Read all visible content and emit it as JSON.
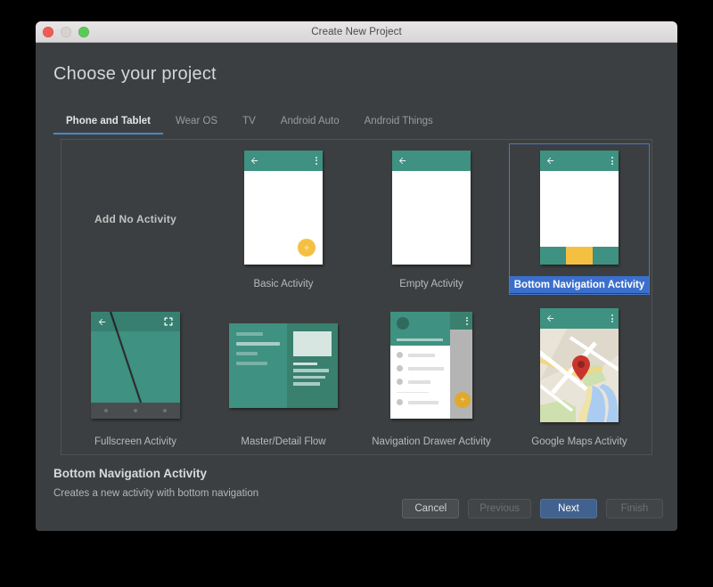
{
  "window": {
    "title": "Create New Project",
    "traffic_lights": [
      "close-red",
      "minimize-gray",
      "zoom-green"
    ]
  },
  "page": {
    "heading": "Choose your project"
  },
  "tabs": [
    {
      "label": "Phone and Tablet",
      "active": true
    },
    {
      "label": "Wear OS",
      "active": false
    },
    {
      "label": "TV",
      "active": false
    },
    {
      "label": "Android Auto",
      "active": false
    },
    {
      "label": "Android Things",
      "active": false
    }
  ],
  "templates": [
    {
      "label": "Add No Activity",
      "kind": "text-only",
      "selected": false
    },
    {
      "label": "Basic Activity",
      "kind": "phone-fab",
      "selected": false
    },
    {
      "label": "Empty Activity",
      "kind": "phone-empty",
      "selected": false
    },
    {
      "label": "Bottom Navigation Activity",
      "kind": "phone-bottomnav",
      "selected": true
    },
    {
      "label": "Fullscreen Activity",
      "kind": "fullscreen",
      "selected": false
    },
    {
      "label": "Master/Detail Flow",
      "kind": "masterdetail",
      "selected": false
    },
    {
      "label": "Navigation Drawer Activity",
      "kind": "navdrawer",
      "selected": false
    },
    {
      "label": "Google Maps Activity",
      "kind": "maps",
      "selected": false
    }
  ],
  "description": {
    "title": "Bottom Navigation Activity",
    "text": "Creates a new activity with bottom navigation"
  },
  "footer": {
    "cancel": "Cancel",
    "previous": "Previous",
    "next": "Next",
    "finish": "Finish"
  },
  "colors": {
    "dialog_bg": "#3c3f41",
    "titlebar_bg": "#e4e2e2",
    "accent_blue": "#3b6fcc",
    "selection_border": "#4a78c4",
    "tab_underline": "#4a88c7",
    "material_teal": "#3f9181",
    "material_teal_dark": "#39806f",
    "fab_amber": "#f5c042",
    "map_land": "#e9e4d8",
    "map_water": "#aaccf0",
    "map_park": "#cde0ae",
    "map_marker": "#c9352c",
    "primary_button": "#41628f"
  }
}
